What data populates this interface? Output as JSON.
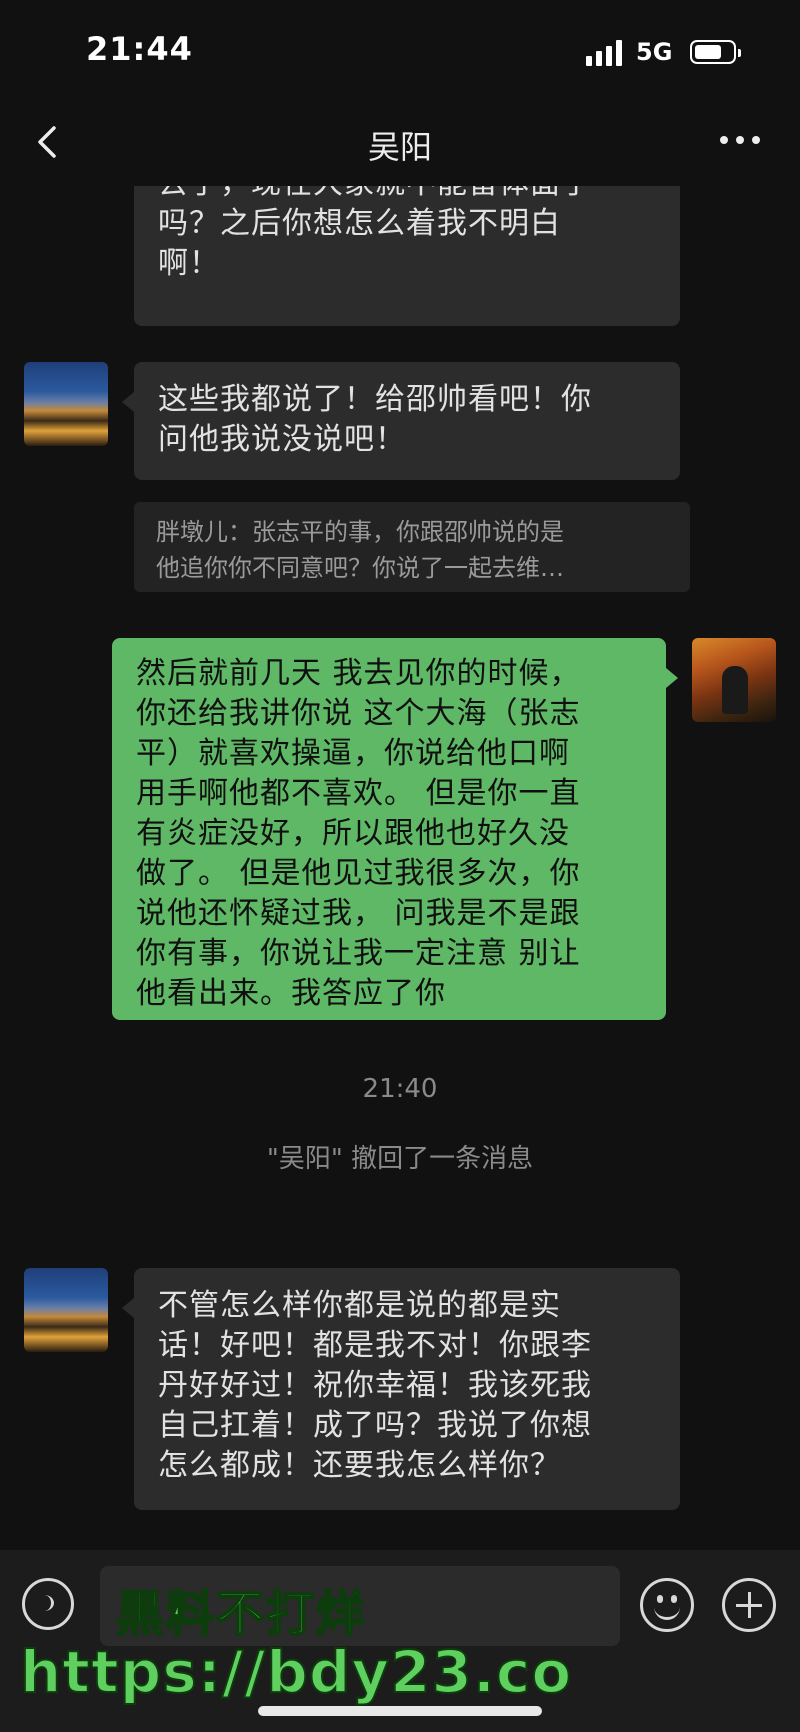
{
  "status_bar": {
    "time": "21:44",
    "network": "5G"
  },
  "nav": {
    "title": "吴阳"
  },
  "messages": {
    "m1_lines": [
      "去了，现在大家就不能留体面了",
      "吗？之后你想怎么着我不明白",
      "啊！"
    ],
    "m2_lines": [
      "这些我都说了！给邵帅看吧！你",
      "问他我说没说吧！"
    ],
    "quote_lines": [
      "胖墩儿：张志平的事，你跟邵帅说的是",
      "他追你你不同意吧？你说了一起去维…"
    ],
    "m3_lines": [
      "然后就前几天 我去见你的时候，",
      "你还给我讲你说 这个大海（张志",
      "平）就喜欢操逼，你说给他口啊",
      "用手啊他都不喜欢。 但是你一直",
      "有炎症没好，所以跟他也好久没",
      "做了。 但是他见过我很多次，你",
      "说他还怀疑过我， 问我是不是跟",
      "你有事，你说让我一定注意 别让",
      "他看出来。我答应了你"
    ],
    "timestamp": "21:40",
    "recall_notice": "\"吴阳\" 撤回了一条消息",
    "m4_lines": [
      "不管怎么样你都是说的都是实",
      "话！好吧！都是我不对！你跟李",
      "丹好好过！祝你幸福！我该死我",
      "自己扛着！成了吗？我说了你想",
      "怎么都成！还要我怎么样你？"
    ]
  },
  "watermark": {
    "line1": "黑料不打烊",
    "line2": "https://bdy23.co"
  },
  "colors": {
    "background": "#111111",
    "received_bubble": "#2c2c2c",
    "sent_bubble": "#5fb866"
  },
  "icons": [
    "back-icon",
    "more-icon",
    "voice-icon",
    "emoji-icon",
    "plus-icon"
  ]
}
